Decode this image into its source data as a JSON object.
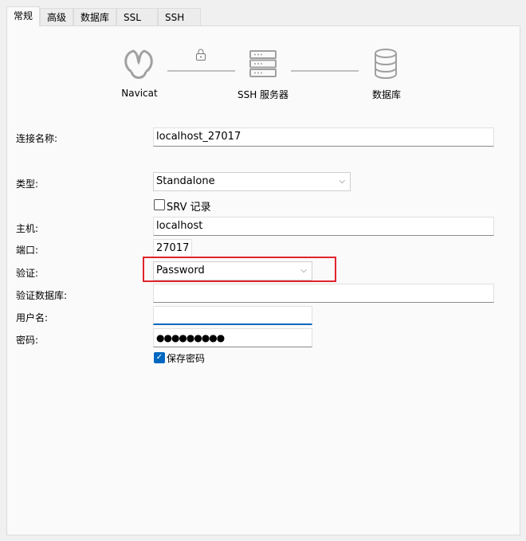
{
  "tabs": [
    {
      "label": "常规",
      "active": true
    },
    {
      "label": "高级"
    },
    {
      "label": "数据库"
    },
    {
      "label": "SSL"
    },
    {
      "label": "SSH"
    }
  ],
  "diagram": {
    "navicat": "Navicat",
    "ssh": "SSH 服务器",
    "database": "数据库",
    "icons": [
      "navicat-logo-icon",
      "lock-icon",
      "server-icon",
      "database-icon"
    ]
  },
  "form": {
    "connection_name_label": "连接名称:",
    "connection_name": "localhost_27017",
    "type_label": "类型:",
    "type": "Standalone",
    "srv_label": "SRV 记录",
    "srv_checked": false,
    "host_label": "主机:",
    "host": "localhost",
    "port_label": "端口:",
    "port": "27017",
    "auth_label": "验证:",
    "auth": "Password",
    "auth_db_label": "验证数据库:",
    "auth_db": "",
    "username_label": "用户名:",
    "username": "",
    "password_label": "密码:",
    "password": "●●●●●●●●●",
    "save_password_label": "保存密码",
    "save_password_checked": true
  },
  "colors": {
    "highlight": "#e0242c",
    "focus": "#0067c0"
  }
}
